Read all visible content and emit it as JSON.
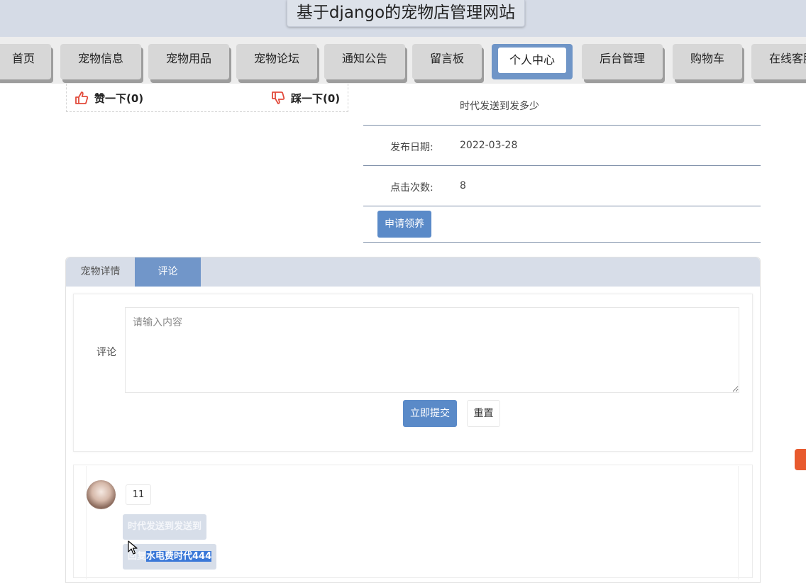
{
  "header": {
    "title": "基于django的宠物店管理网站"
  },
  "nav": {
    "items": [
      {
        "label": "首页"
      },
      {
        "label": "宠物信息"
      },
      {
        "label": "宠物用品"
      },
      {
        "label": "宠物论坛"
      },
      {
        "label": "通知公告"
      },
      {
        "label": "留言板"
      },
      {
        "label": "个人中心",
        "active": true
      },
      {
        "label": "后台管理"
      },
      {
        "label": "购物车"
      },
      {
        "label": "在线客服"
      }
    ]
  },
  "votes": {
    "like": "赞一下(0)",
    "dislike": "踩一下(0)"
  },
  "details": {
    "intro_value": "时代发送到发多少",
    "publish_date_label": "发布日期:",
    "publish_date_value": "2022-03-28",
    "click_count_label": "点击次数:",
    "click_count_value": "8",
    "apply_button": "申请领养"
  },
  "tabs": [
    {
      "label": "宠物详情",
      "active": false
    },
    {
      "label": "评论",
      "active": true
    }
  ],
  "comment_form": {
    "label": "评论",
    "placeholder": "请输入内容",
    "submit": "立即提交",
    "reset": "重置"
  },
  "comments": [
    {
      "user": "11",
      "content": "时代发送到发送到",
      "reply_prefix": "回复",
      "reply_text": "水电费时代444"
    }
  ],
  "colors": {
    "accent": "#5a8ac8",
    "tab_active": "#7196c9",
    "header_band": "#d5dbe6",
    "highlight": "#3a78d8"
  }
}
